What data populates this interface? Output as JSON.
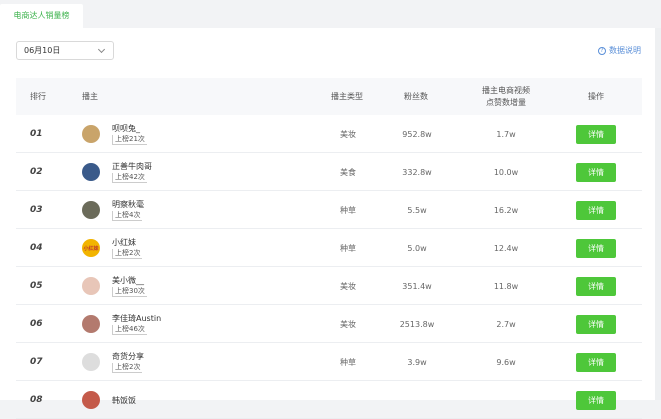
{
  "tab": {
    "label": "电商达人销量榜"
  },
  "filter": {
    "date": "06月10日"
  },
  "help": {
    "label": "数据说明"
  },
  "columns": {
    "rank": "排行",
    "host": "播主",
    "type": "播主类型",
    "fans": "粉丝数",
    "incr_line1": "播主电商视频",
    "incr_line2": "点赞数增量",
    "op": "操作"
  },
  "rows": [
    {
      "rank": "01",
      "name": "呗呗兔_",
      "times": "上榜21次",
      "type": "美妆",
      "fans": "952.8w",
      "incr": "1.7w",
      "action": "详情",
      "avatar_color": "#c9a46a"
    },
    {
      "rank": "02",
      "name": "正善牛肉哥",
      "times": "上榜42次",
      "type": "美食",
      "fans": "332.8w",
      "incr": "10.0w",
      "action": "详情",
      "avatar_color": "#3a5a8a"
    },
    {
      "rank": "03",
      "name": "明察秋毫",
      "times": "上榜4次",
      "type": "种草",
      "fans": "5.5w",
      "incr": "16.2w",
      "action": "详情",
      "avatar_color": "#6b6b5a"
    },
    {
      "rank": "04",
      "name": "小红妹",
      "times": "上榜2次",
      "type": "种草",
      "fans": "5.0w",
      "incr": "12.4w",
      "action": "详情",
      "avatar_color": "#f2b400",
      "avatar_text": "小红妹"
    },
    {
      "rank": "05",
      "name": "美小微__",
      "times": "上榜30次",
      "type": "美妆",
      "fans": "351.4w",
      "incr": "11.8w",
      "action": "详情",
      "avatar_color": "#e8c6b8"
    },
    {
      "rank": "06",
      "name": "李佳琦Austin",
      "times": "上榜46次",
      "type": "美妆",
      "fans": "2513.8w",
      "incr": "2.7w",
      "action": "详情",
      "avatar_color": "#b37a6e"
    },
    {
      "rank": "07",
      "name": "奇货分享",
      "times": "上榜2次",
      "type": "种草",
      "fans": "3.9w",
      "incr": "9.6w",
      "action": "详情",
      "avatar_color": "#dddddd"
    },
    {
      "rank": "08",
      "name": "韩饭饭",
      "times": "",
      "type": "",
      "fans": "",
      "incr": "",
      "action": "详情",
      "avatar_color": "#c45a4a"
    }
  ]
}
